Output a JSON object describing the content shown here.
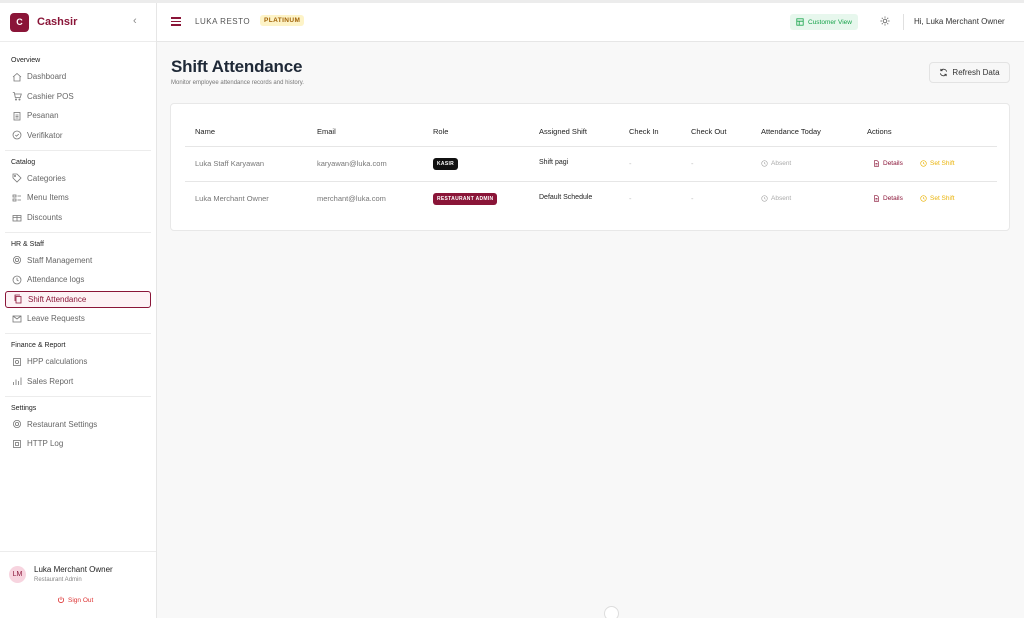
{
  "brand": {
    "logo_letter": "C",
    "name": "Cashsir",
    "color": "#8a1538"
  },
  "sidebar": {
    "sections": [
      {
        "title": "Overview",
        "items": [
          {
            "label": "Dashboard",
            "icon": "home-icon"
          },
          {
            "label": "Cashier POS",
            "icon": "cart-icon"
          },
          {
            "label": "Pesanan",
            "icon": "clipboard-icon"
          },
          {
            "label": "Verifikator",
            "icon": "check-circle-icon"
          }
        ]
      },
      {
        "title": "Catalog",
        "items": [
          {
            "label": "Categories",
            "icon": "tag-icon"
          },
          {
            "label": "Menu Items",
            "icon": "menu-icon"
          },
          {
            "label": "Discounts",
            "icon": "gift-icon"
          }
        ]
      },
      {
        "title": "HR & Staff",
        "items": [
          {
            "label": "Staff Management",
            "icon": "gear-icon"
          },
          {
            "label": "Attendance logs",
            "icon": "clock-icon"
          },
          {
            "label": "Shift Attendance",
            "icon": "copy-icon",
            "active": true
          },
          {
            "label": "Leave Requests",
            "icon": "mail-icon"
          }
        ]
      },
      {
        "title": "Finance & Report",
        "items": [
          {
            "label": "HPP calculations",
            "icon": "calculator-icon"
          },
          {
            "label": "Sales Report",
            "icon": "bar-chart-icon"
          }
        ]
      },
      {
        "title": "Settings",
        "items": [
          {
            "label": "Restaurant Settings",
            "icon": "gear-icon"
          },
          {
            "label": "HTTP Log",
            "icon": "chip-icon"
          }
        ]
      }
    ],
    "user": {
      "initials": "LM",
      "name": "Luka Merchant Owner",
      "role": "Restaurant Admin",
      "sign_out": "Sign Out"
    }
  },
  "header": {
    "restaurant": "LUKA RESTO",
    "plan": "PLATINUM",
    "customer_view": "Customer View",
    "greeting": "Hi, Luka Merchant Owner"
  },
  "page": {
    "title": "Shift Attendance",
    "subtitle": "Monitor employee attendance records and history.",
    "refresh_label": "Refresh Data"
  },
  "table": {
    "headers": [
      "Name",
      "Email",
      "Role",
      "Assigned Shift",
      "Check In",
      "Check Out",
      "Attendance Today",
      "Actions"
    ],
    "rows": [
      {
        "name": "Luka Staff Karyawan",
        "email": "karyawan@luka.com",
        "role": "KASIR",
        "role_color": "#111111",
        "shift": "Shift pagi",
        "check_in": "-",
        "check_out": "-",
        "attendance": "Absent",
        "details": "Details",
        "set_shift": "Set Shift"
      },
      {
        "name": "Luka Merchant Owner",
        "email": "merchant@luka.com",
        "role": "RESTAURANT ADMIN",
        "role_color": "#8a1538",
        "shift": "Default Schedule",
        "check_in": "-",
        "check_out": "-",
        "attendance": "Absent",
        "details": "Details",
        "set_shift": "Set Shift"
      }
    ]
  }
}
